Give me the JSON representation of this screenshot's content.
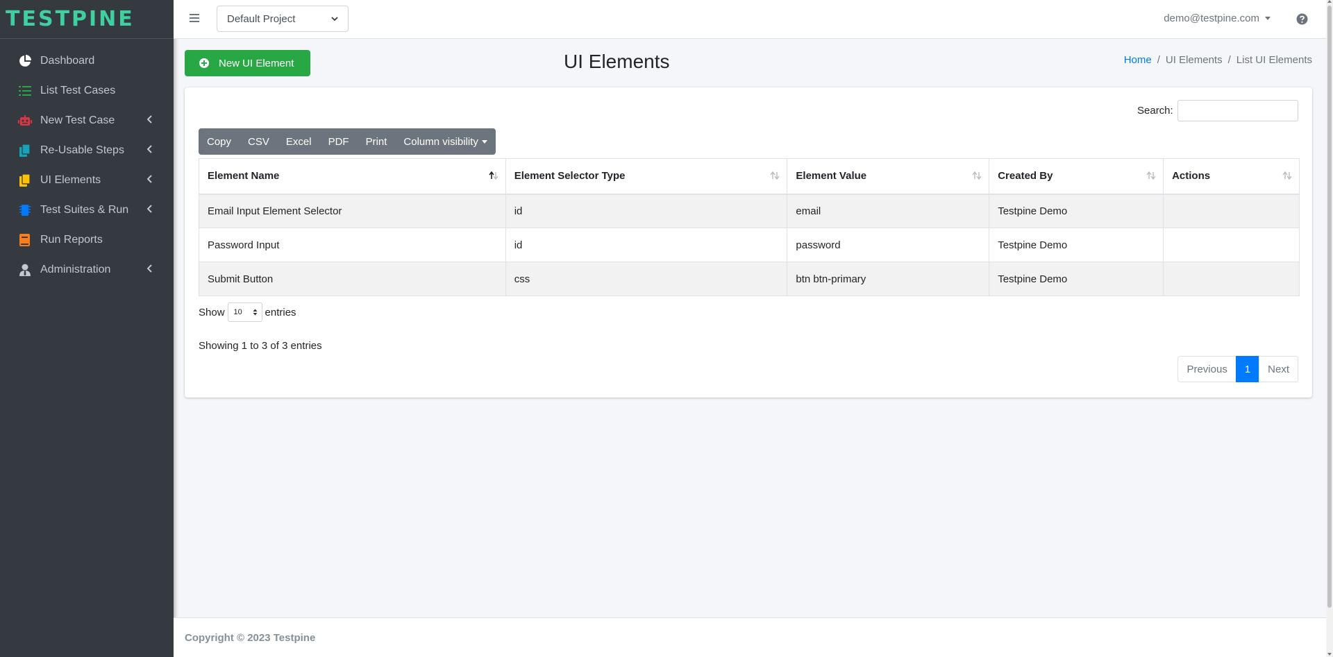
{
  "brand": {
    "name": "TESTPINE",
    "color": "#3fd0a0"
  },
  "sidebar": {
    "items": [
      {
        "label": "Dashboard",
        "icon": "pie-chart-icon",
        "color": "#ffffff",
        "has_chevron": false
      },
      {
        "label": "List Test Cases",
        "icon": "list-icon",
        "color": "#28a745",
        "has_chevron": false
      },
      {
        "label": "New Test Case",
        "icon": "robot-icon",
        "color": "#dc3545",
        "has_chevron": true
      },
      {
        "label": "Re-Usable Steps",
        "icon": "copy-icon",
        "color": "#17a2b8",
        "has_chevron": true
      },
      {
        "label": "UI Elements",
        "icon": "file-icon",
        "color": "#ffc107",
        "has_chevron": true
      },
      {
        "label": "Test Suites & Run",
        "icon": "microchip-icon",
        "color": "#007bff",
        "has_chevron": true
      },
      {
        "label": "Run Reports",
        "icon": "book-icon",
        "color": "#fd7e14",
        "has_chevron": false
      },
      {
        "label": "Administration",
        "icon": "user-tie-icon",
        "color": "#c2c7d0",
        "has_chevron": true
      }
    ]
  },
  "topbar": {
    "project": "Default Project",
    "user": "demo@testpine.com",
    "help_icon": "question-circle-icon"
  },
  "header": {
    "new_button": "New UI Element",
    "title": "UI Elements",
    "breadcrumb": {
      "home": "Home",
      "section": "UI Elements",
      "current": "List UI Elements"
    }
  },
  "table_controls": {
    "search_label": "Search:",
    "search_value": "",
    "buttons": {
      "copy": "Copy",
      "csv": "CSV",
      "excel": "Excel",
      "pdf": "PDF",
      "print": "Print",
      "colvis": "Column visibility"
    },
    "show_label": "Show",
    "page_length": "10",
    "entries_label": "entries",
    "info": "Showing 1 to 3 of 3 entries",
    "pagination": {
      "previous": "Previous",
      "current": "1",
      "next": "Next"
    }
  },
  "table": {
    "columns": [
      "Element Name",
      "Element Selector Type",
      "Element Value",
      "Created By",
      "Actions"
    ],
    "rows": [
      [
        "Email Input Element Selector",
        "id",
        "email",
        "Testpine Demo",
        ""
      ],
      [
        "Password Input",
        "id",
        "password",
        "Testpine Demo",
        ""
      ],
      [
        "Submit Button",
        "css",
        "btn btn-primary",
        "Testpine Demo",
        ""
      ]
    ]
  },
  "footer": {
    "text": "Copyright © 2023 Testpine"
  },
  "colors": {
    "sidebar_bg": "#343a40",
    "accent_green": "#28a745",
    "link_blue": "#007bff",
    "button_gray": "#6c757d"
  }
}
